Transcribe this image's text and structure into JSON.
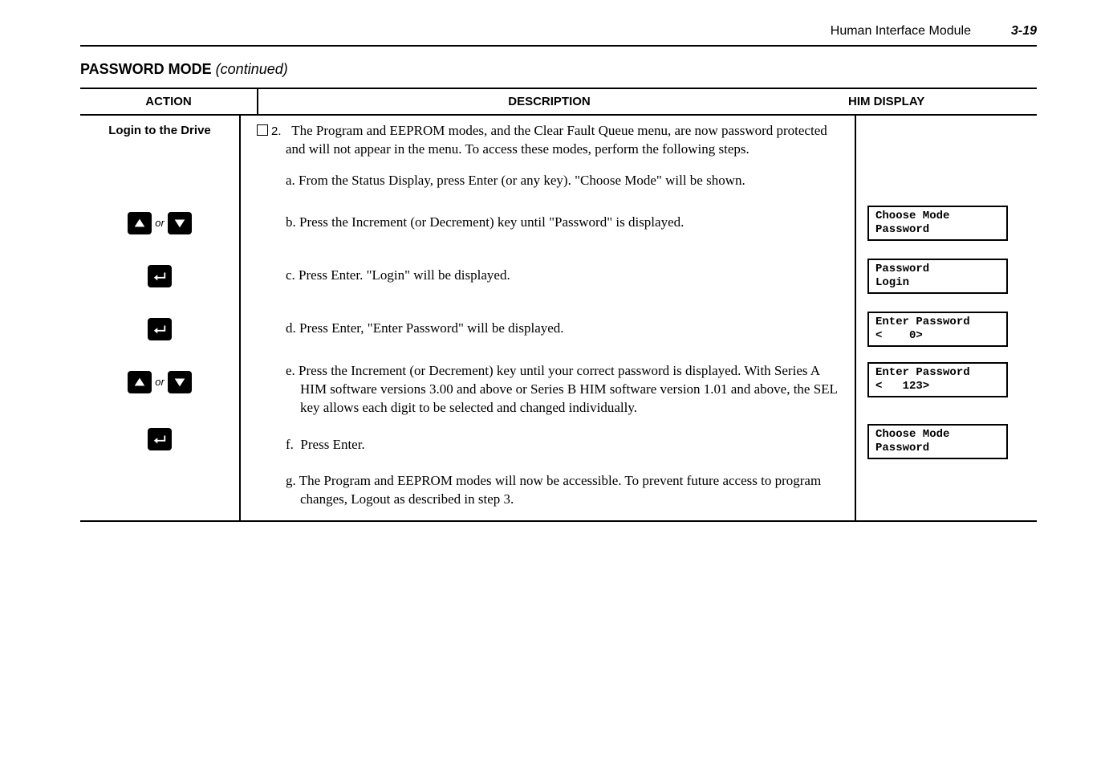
{
  "header": {
    "title": "Human Interface Module",
    "page_num": "3-19"
  },
  "section": {
    "title": "PASSWORD MODE",
    "cont": " (continued)"
  },
  "table": {
    "headers": {
      "action": "ACTION",
      "description": "DESCRIPTION",
      "him": "HIM DISPLAY"
    },
    "action_label": "Login to the Drive",
    "step_prefix": "2.",
    "step2_intro": "The Program and EEPROM modes, and the Clear Fault Queue menu, are now password protected and will not appear in the menu. To access these modes, perform the following steps.",
    "items": [
      {
        "letter": "a.",
        "text": "From the Status Display, press Enter (or any key). \"Choose Mode\" will be shown.",
        "him": null,
        "icon": null
      },
      {
        "letter": "b.",
        "text": "Press the Increment (or Decrement) key until \"Password\" is displayed.",
        "him": "Choose Mode\nPassword",
        "icon": "updown"
      },
      {
        "letter": "c.",
        "text": "Press Enter. \"Login\" will be displayed.",
        "him": "Password\nLogin",
        "icon": "enter"
      },
      {
        "letter": "d.",
        "text": "Press Enter, \"Enter Password\" will be displayed.",
        "him": "Enter Password\n<    0>",
        "icon": "enter"
      },
      {
        "letter": "e.",
        "text": "Press the Increment (or Decrement) key until your correct password is displayed. With Series A HIM software versions 3.00 and above or Series B HIM software version 1.01 and above, the SEL key allows each digit to be selected and changed individually.",
        "him": "Enter Password\n<   123>",
        "icon": "updown"
      },
      {
        "letter": "f.",
        "text": "Press Enter.",
        "him": "Choose Mode\nPassword",
        "icon": "enter"
      },
      {
        "letter": "g.",
        "text": "The Program and EEPROM modes will now be accessible. To prevent future access to program changes, Logout as described in step 3.",
        "him": null,
        "icon": null
      }
    ],
    "or_label": "or"
  }
}
